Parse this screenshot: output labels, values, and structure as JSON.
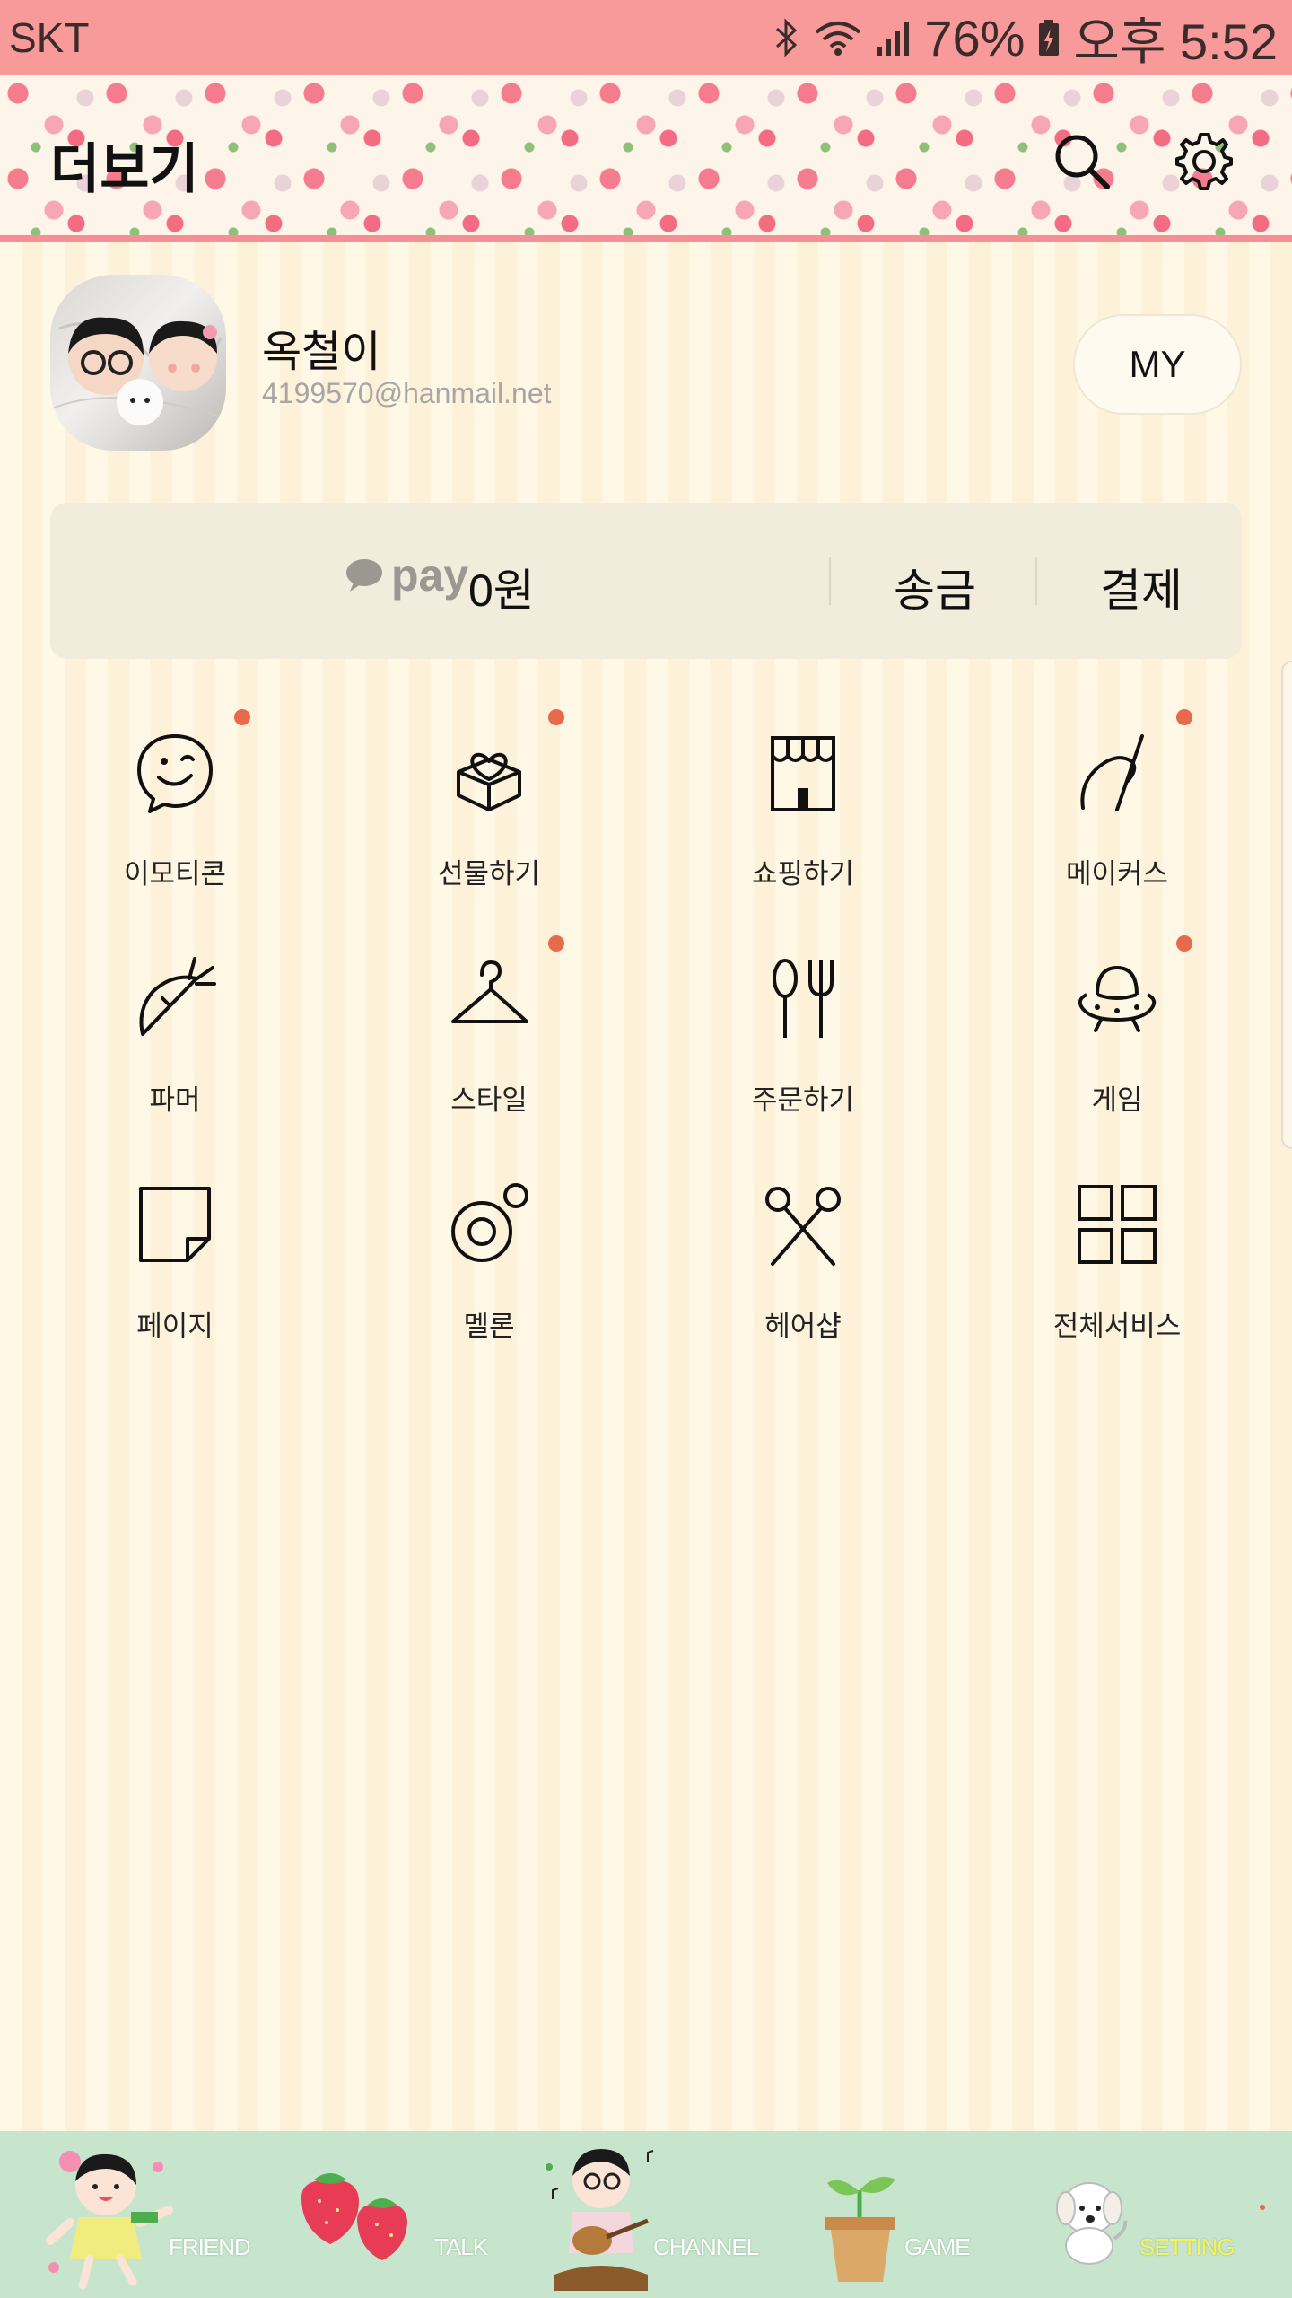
{
  "status_bar": {
    "carrier": "SKT",
    "battery_percent": "76%",
    "time": "오후 5:52",
    "icons": [
      "bluetooth-icon",
      "wifi-icon",
      "signal-icon",
      "battery-icon"
    ]
  },
  "header": {
    "title": "더보기",
    "icons": [
      "search-icon",
      "gear-icon"
    ]
  },
  "profile": {
    "name": "옥철이",
    "email": "4199570@hanmail.net",
    "my_button": "MY"
  },
  "pay": {
    "logo": "pay",
    "amount": "0원",
    "send": "송금",
    "payment": "결제"
  },
  "menu": {
    "items": [
      {
        "label": "이모티콘",
        "icon": "emoticon-icon",
        "new": true
      },
      {
        "label": "선물하기",
        "icon": "gift-icon",
        "new": true
      },
      {
        "label": "쇼핑하기",
        "icon": "shop-icon",
        "new": false
      },
      {
        "label": "메이커스",
        "icon": "needle-icon",
        "new": true
      },
      {
        "label": "파머",
        "icon": "carrot-icon",
        "new": false
      },
      {
        "label": "스타일",
        "icon": "hanger-icon",
        "new": true
      },
      {
        "label": "주문하기",
        "icon": "fork-spoon-icon",
        "new": false
      },
      {
        "label": "게임",
        "icon": "ufo-icon",
        "new": true
      },
      {
        "label": "페이지",
        "icon": "page-icon",
        "new": false
      },
      {
        "label": "멜론",
        "icon": "melon-icon",
        "new": false
      },
      {
        "label": "헤어샵",
        "icon": "scissors-icon",
        "new": false
      },
      {
        "label": "전체서비스",
        "icon": "grid-icon",
        "new": false
      }
    ]
  },
  "bottom_nav": {
    "items": [
      {
        "label": "FRIEND",
        "active": false
      },
      {
        "label": "TALK",
        "active": false
      },
      {
        "label": "CHANNEL",
        "active": false
      },
      {
        "label": "GAME",
        "active": false
      },
      {
        "label": "SETTING",
        "active": true
      }
    ]
  },
  "colors": {
    "status_bar": "#f99a9a",
    "new_dot": "#e86a4d",
    "bottom_nav": "#c7e5cd",
    "active_tab": "#f5f25a"
  }
}
